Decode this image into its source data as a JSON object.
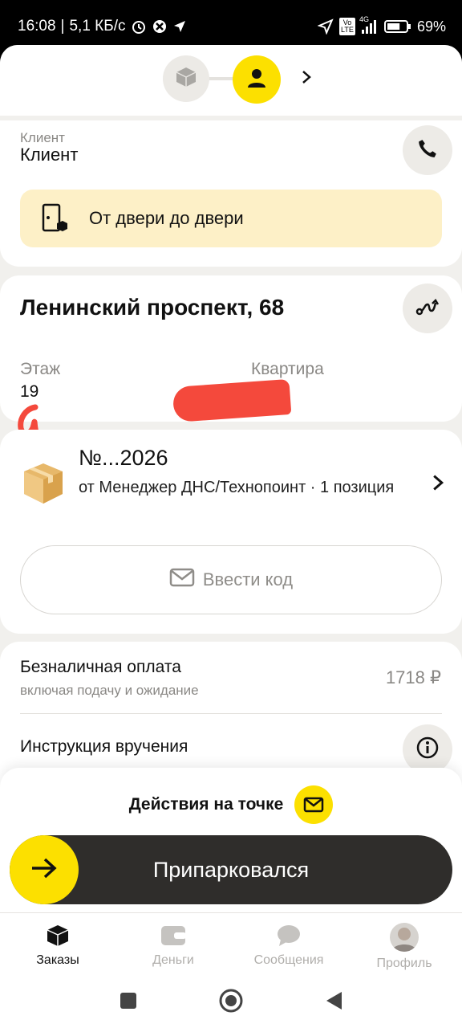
{
  "status_bar": {
    "time": "16:08",
    "net_speed": "5,1 КБ/с",
    "lte_badge": "Vo LTE",
    "network": "4G",
    "battery": "69%",
    "battery_level": 0.69,
    "icons": [
      "alarm-icon",
      "shield-icon",
      "location-arrow-icon",
      "signal-icon",
      "battery-icon"
    ]
  },
  "progress": {
    "icons": [
      "box-icon",
      "user-icon",
      "chevron-right-icon"
    ]
  },
  "client": {
    "caption": "Клиент",
    "name": "Клиент",
    "delivery_type": "От двери до двери"
  },
  "address": {
    "street": "Ленинский проспект, 68",
    "floor_label": "Этаж",
    "floor_value": "19",
    "apartment_label": "Квартира"
  },
  "order": {
    "number": "№...2026",
    "from": "от Менеджер ДНС/Технопоинт · 1 позиция",
    "enter_code": "Ввести код"
  },
  "payment": {
    "title": "Безналичная оплата",
    "subtitle": "включая подачу и ожидание",
    "amount": "1718 ₽",
    "instruction": "Инструкция вручения"
  },
  "sheet": {
    "actions_label": "Действия на точке",
    "park_label": "Припарковался"
  },
  "tabs": [
    {
      "label": "Заказы",
      "icon": "cube-icon",
      "active": true
    },
    {
      "label": "Деньги",
      "icon": "wallet-icon",
      "active": false
    },
    {
      "label": "Сообщения",
      "icon": "chat-icon",
      "active": false
    },
    {
      "label": "Профиль",
      "icon": "avatar",
      "active": false
    }
  ],
  "colors": {
    "accent_yellow": "#fce000",
    "banner": "#fdf0c7",
    "dark_button": "#2f2d2b",
    "redaction": "#f4493c"
  }
}
